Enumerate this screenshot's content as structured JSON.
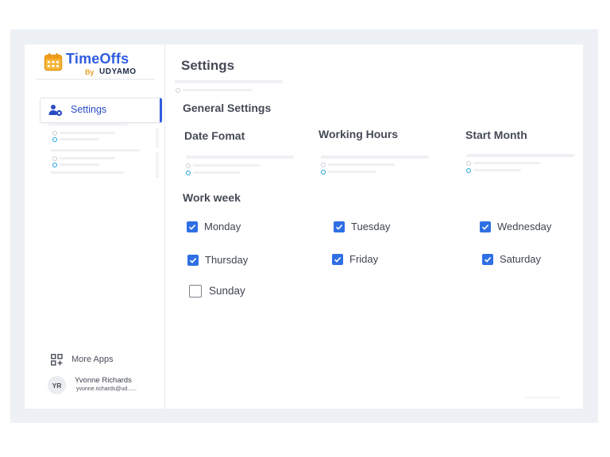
{
  "app": {
    "title": "TimeOffs",
    "by": "By",
    "brand": "UDYAMO",
    "accent": "#2f5de0"
  },
  "sidebar": {
    "nav": [
      {
        "label": "Settings",
        "icon": "user-gear-icon",
        "active": true
      }
    ],
    "more_apps": {
      "label": "More Apps",
      "icon": "apps-grid-plus-icon"
    },
    "user": {
      "initials": "YR",
      "name": "Yvonne Richards",
      "email": "yvonne.richards@ud......"
    }
  },
  "main": {
    "title": "Settings",
    "section": "General Settings",
    "fields": [
      {
        "label": "Date Fomat"
      },
      {
        "label": "Working Hours"
      },
      {
        "label": "Start Month"
      }
    ],
    "work_week": {
      "title": "Work week",
      "days": [
        {
          "label": "Monday",
          "checked": true
        },
        {
          "label": "Tuesday",
          "checked": true
        },
        {
          "label": "Wednesday",
          "checked": true
        },
        {
          "label": "Thursday",
          "checked": true
        },
        {
          "label": "Friday",
          "checked": true
        },
        {
          "label": "Saturday",
          "checked": true
        },
        {
          "label": "Sunday",
          "checked": false
        }
      ]
    }
  }
}
